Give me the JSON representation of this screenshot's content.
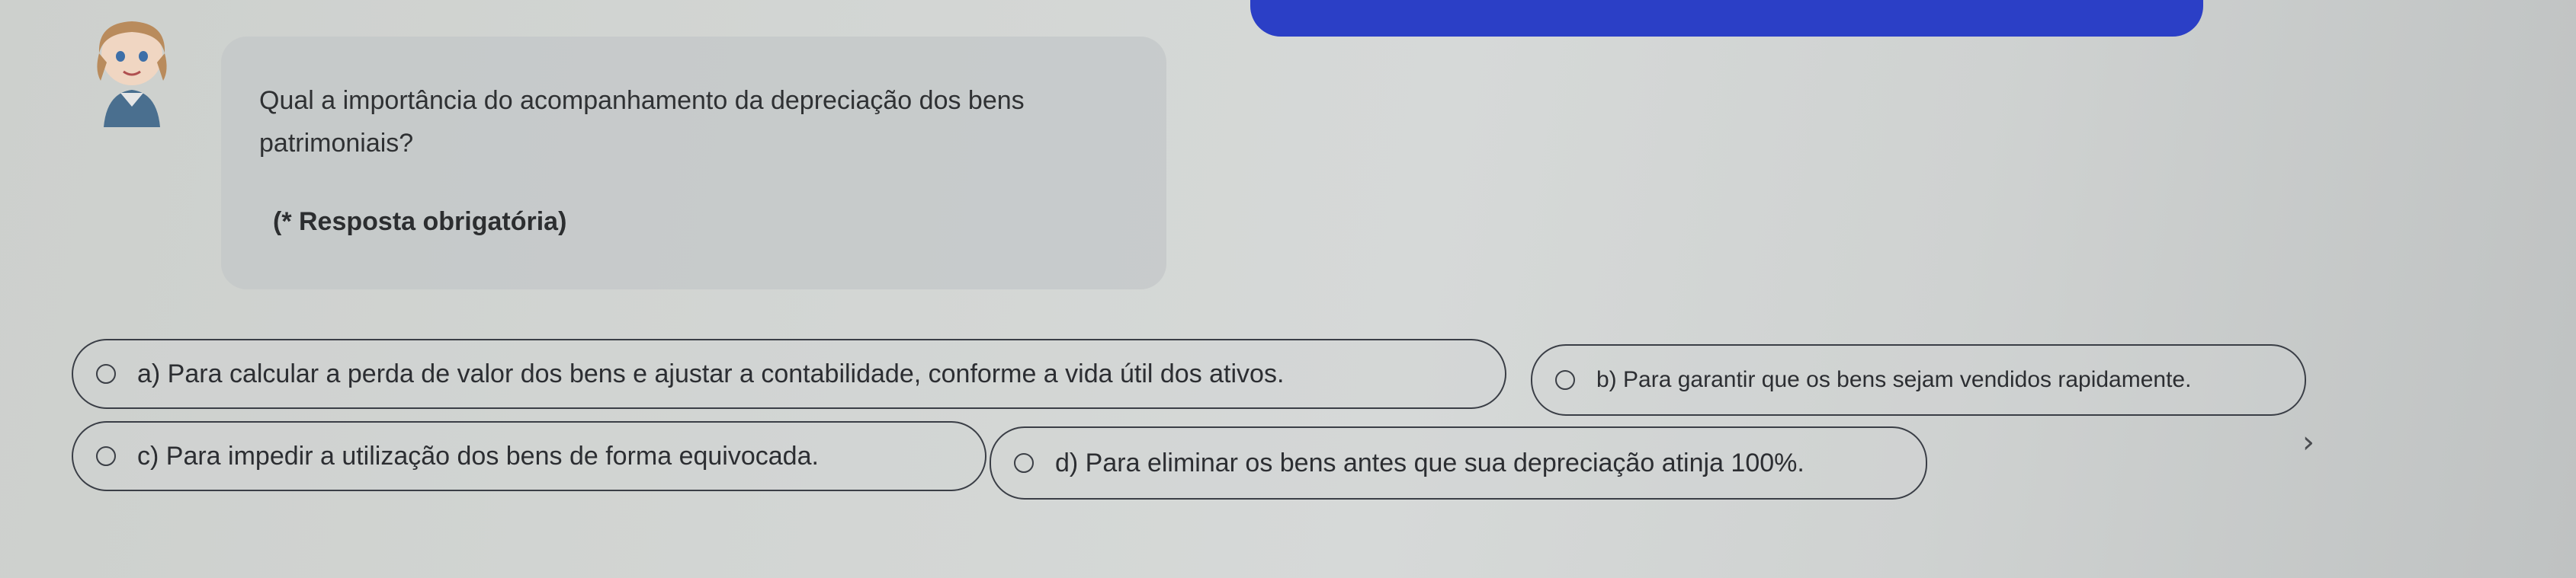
{
  "question": {
    "text": "Qual a importância do acompanhamento da depreciação dos bens patrimoniais?",
    "required_note": "(* Resposta obrigatória)"
  },
  "options": [
    {
      "id": "a",
      "label": "a) Para calcular a perda de valor dos bens e ajustar a contabilidade, conforme a vida útil dos ativos."
    },
    {
      "id": "b",
      "label": "b) Para garantir que os bens sejam vendidos rapidamente."
    },
    {
      "id": "c",
      "label": "c) Para impedir a utilização dos bens de forma equivocada."
    },
    {
      "id": "d",
      "label": "d) Para eliminar os bens antes que sua depreciação atinja 100%."
    }
  ],
  "icons": {
    "avatar": "avatar-icon",
    "next": "chevron-right-icon"
  },
  "colors": {
    "accent": "#2b3fc6",
    "bubble": "#c3c7c8",
    "text": "#2f3133"
  }
}
